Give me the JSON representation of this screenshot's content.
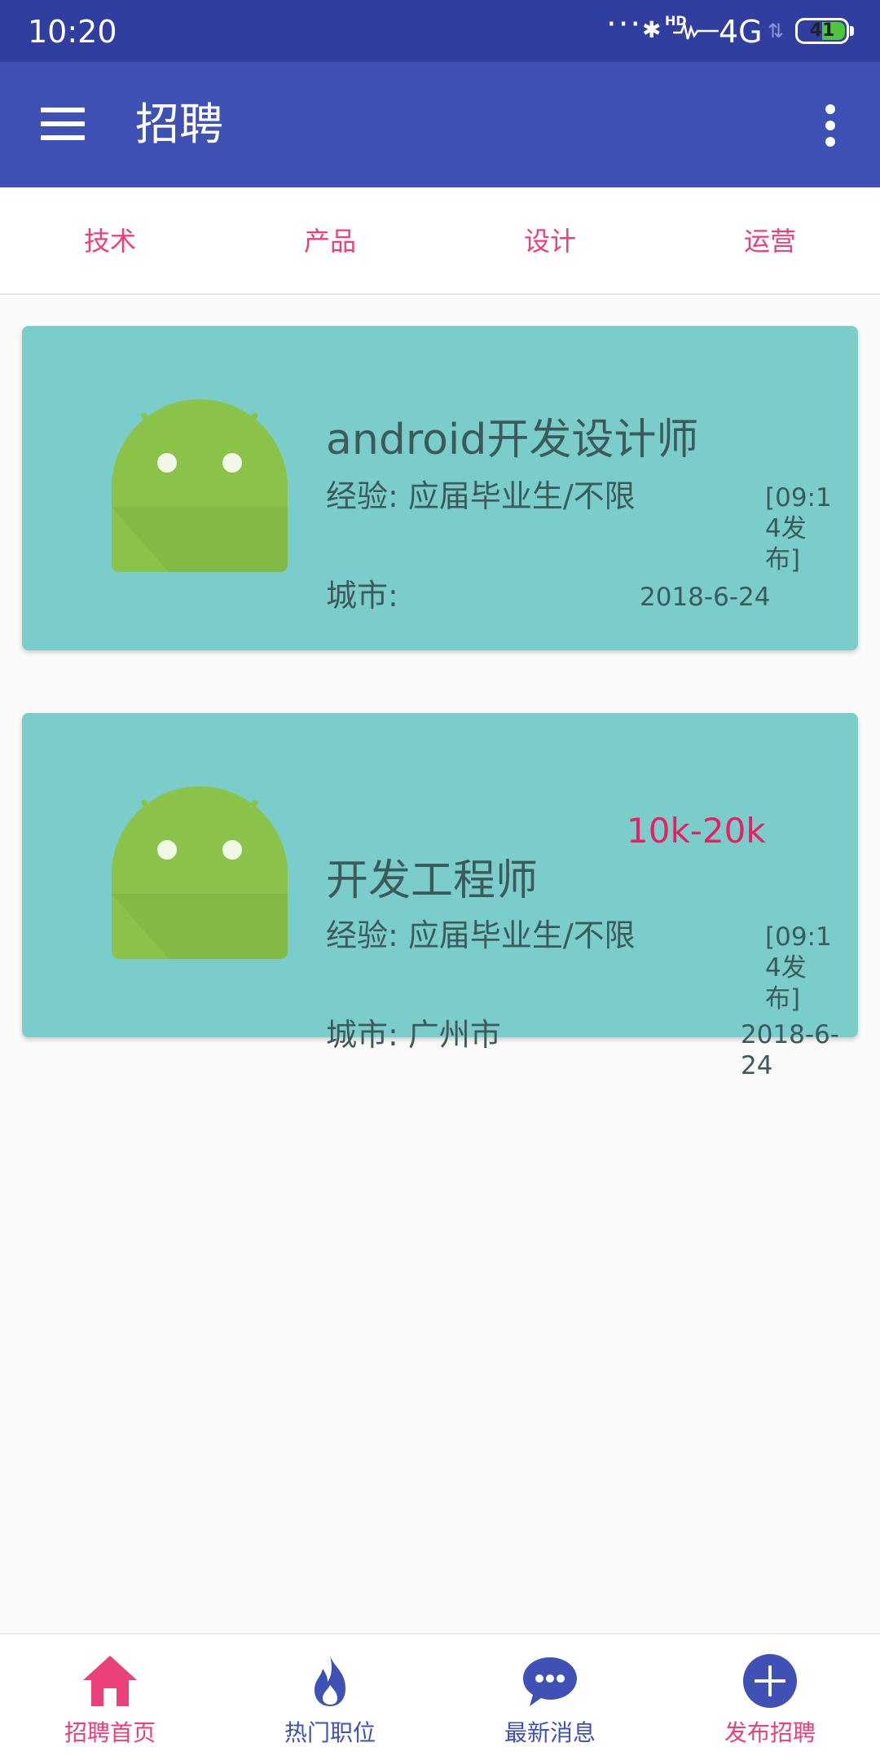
{
  "status_bar": {
    "time": "10:20",
    "network": "4G",
    "hd_label": "HD",
    "battery": "41"
  },
  "app_bar": {
    "title": "招聘"
  },
  "tabs": [
    {
      "label": "技术"
    },
    {
      "label": "产品"
    },
    {
      "label": "设计"
    },
    {
      "label": "运营"
    }
  ],
  "jobs": [
    {
      "title": "android开发设计师",
      "salary": "",
      "experience": "经验: 应届毕业生/不限",
      "city": "城市:",
      "published": "[09:14发布]",
      "date": "2018-6-24"
    },
    {
      "title": "开发工程师",
      "salary": "10k-20k",
      "experience": "经验: 应届毕业生/不限",
      "city": "城市: 广州市",
      "published": "[09:14发布]",
      "date": "2018-6-24"
    }
  ],
  "bottom_nav": [
    {
      "label": "招聘首页",
      "icon": "home-icon",
      "color": "#ec407a"
    },
    {
      "label": "热门职位",
      "icon": "fire-icon",
      "color": "#3f51b5"
    },
    {
      "label": "最新消息",
      "icon": "chat-bubble-icon",
      "color": "#3f51b5"
    },
    {
      "label": "发布招聘",
      "icon": "add-circle-icon",
      "color": "#ec407a"
    }
  ],
  "colors": {
    "status_bar": "#303f9f",
    "primary": "#3f51b5",
    "accent": "#ec407a",
    "card": "#7bcdcb",
    "salary": "#e91e63"
  }
}
